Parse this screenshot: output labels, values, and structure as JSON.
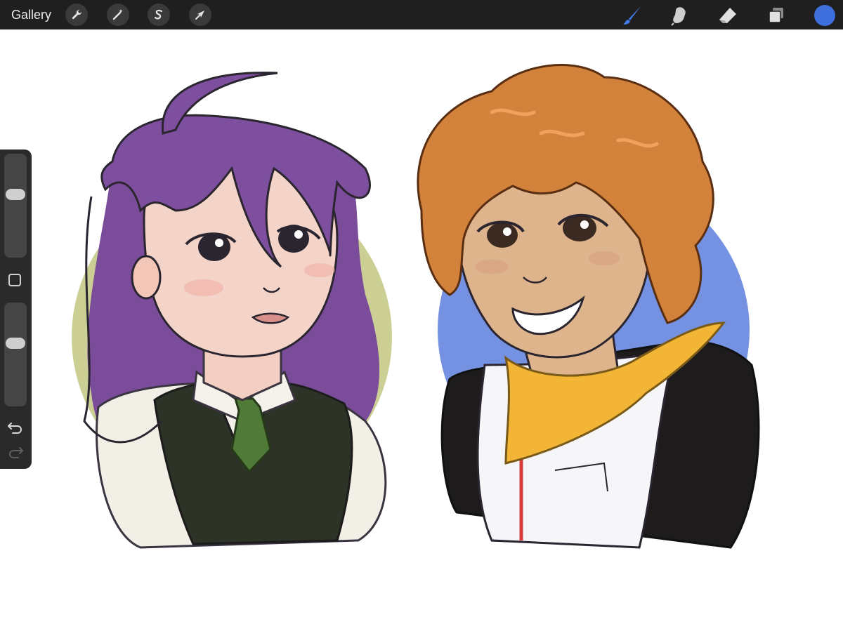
{
  "toolbar": {
    "gallery_label": "Gallery",
    "left_tools": [
      "wrench-icon",
      "magic-wand-icon",
      "selection-icon",
      "transform-arrow-icon"
    ],
    "right_tools": [
      "brush-icon",
      "smudge-icon",
      "eraser-icon",
      "layers-icon"
    ],
    "active_tool": "brush-icon",
    "active_color": "#3f6fdc",
    "accent": "#3f7ee8"
  },
  "sidebar": {
    "brush_size": 0.62,
    "opacity": 0.62,
    "controls": [
      "brush-size-slider",
      "modify-button",
      "opacity-slider",
      "undo-icon",
      "redo-icon"
    ]
  },
  "canvas": {
    "colors": {
      "left_backdrop": "#c9cc8e",
      "right_backdrop": "#6d8be0",
      "purple_hair": "#7a4c9a",
      "orange_hair": "#d2823a",
      "skin_left": "#f4d4c8",
      "skin_right": "#ddb48c",
      "vest": "#2d3326",
      "tie": "#4f7a38",
      "bandana": "#f2b536",
      "jacket_black": "#1d1b1c",
      "zipper_red": "#d63a3a"
    }
  }
}
